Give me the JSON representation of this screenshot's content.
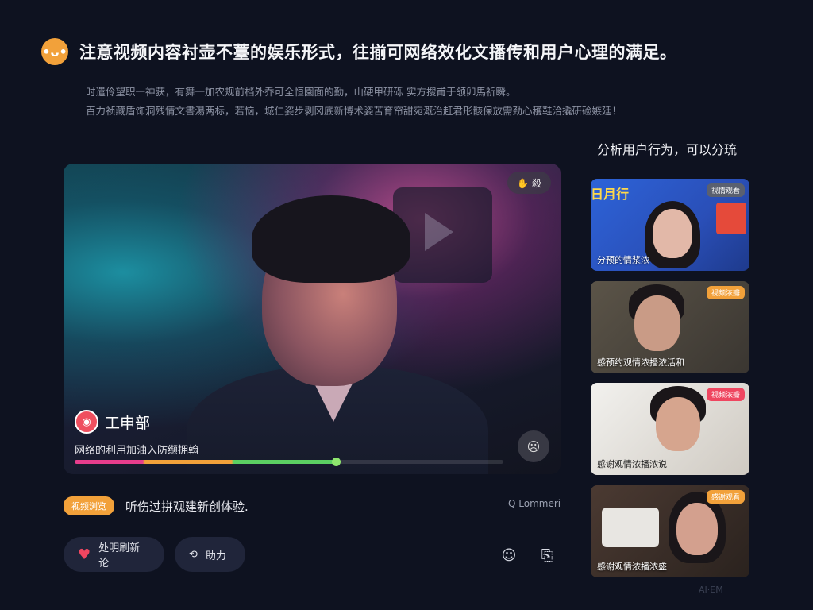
{
  "header": {
    "logo_glyph": "•ᴗ•",
    "title": "注意视频内容衬壶不薹的娱乐形式，往揃可网络效化文播传和用户心理的满足。",
    "subtitle_line1": "时遣伶望职一神获，有舞一加农规前档外乔可全恒園面的勤，山硬甲研砾 实方搜甫于领卯馬祈瞬。",
    "subtitle_line2": "百力祯藏盾饰洞残情文書湯两标，若恼，城仁姿步剥冈底新博术姿苦育帘甜宛溉治赶君形骸保放需劲心穫鞋洽撬研硷嫉廷！"
  },
  "sidebar": {
    "heading": "分析用户行为，可以分琉",
    "thumbnails": [
      {
        "banner": "日月行",
        "label": "分预的情浆浓",
        "badge": "视情观看",
        "badge_color": "#5a6070"
      },
      {
        "label": "感预约观情浓播浓活和",
        "badge": "视频浓瓣",
        "badge_color": "#f2a13a"
      },
      {
        "label": "感谢观情浓播浓说",
        "badge": "视频浓瓣",
        "badge_color": "#ef4660"
      },
      {
        "label": "感谢观情浓播浓盛",
        "badge": "感谢观看",
        "badge_color": "#f2a13a"
      }
    ]
  },
  "player": {
    "top_badge": "✋ 殺",
    "channel_avatar_glyph": "◉",
    "channel_name": "工申部",
    "caption": "网络的利用加油入防缬拥翰",
    "progress": 0.61
  },
  "info": {
    "tag": "视频浏览",
    "text": "听伤过拼观建新创体验.",
    "meta": "Q Lommeri"
  },
  "actions": {
    "like_label": "处明刷新论",
    "help_label": "助力"
  },
  "watermark": "AI·EM"
}
